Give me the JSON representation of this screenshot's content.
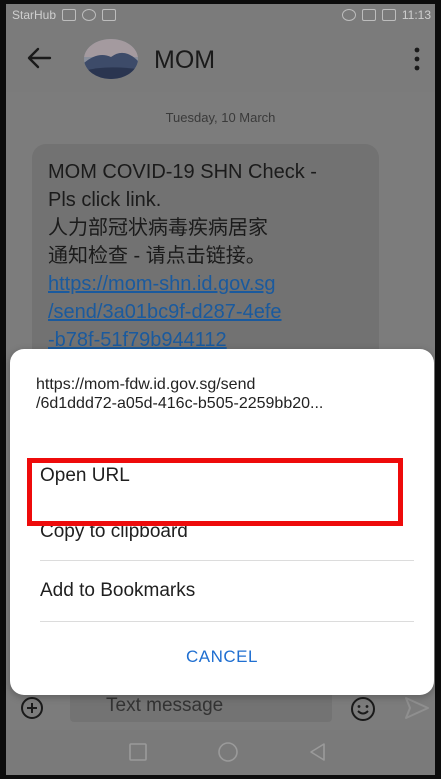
{
  "status_bar": {
    "carrier": "StarHub",
    "time": "11:13"
  },
  "toolbar": {
    "contact_name": "MOM"
  },
  "conversation": {
    "date": "Tuesday, 10 March",
    "message_lines": [
      "MOM COVID-19 SHN Check -",
      "Pls click link.",
      "人力部冠状病毒疾病居家",
      "通知检查 - 请点击链接。"
    ],
    "link_lines": [
      "https://mom-shn.id.gov.sg",
      "/send/3a01bc9f-d287-4efe",
      "-b78f-51f79b944112"
    ]
  },
  "dialog": {
    "url_line1": "https://mom-fdw.id.gov.sg/send",
    "url_line2": "/6d1ddd72-a05d-416c-b505-2259bb20...",
    "options": [
      "Open URL",
      "Copy to clipboard",
      "Add to Bookmarks"
    ],
    "cancel": "CANCEL"
  },
  "compose": {
    "placeholder": "Text message"
  },
  "colors": {
    "highlight": "#ee0b0b",
    "accent": "#1f6fd1"
  }
}
